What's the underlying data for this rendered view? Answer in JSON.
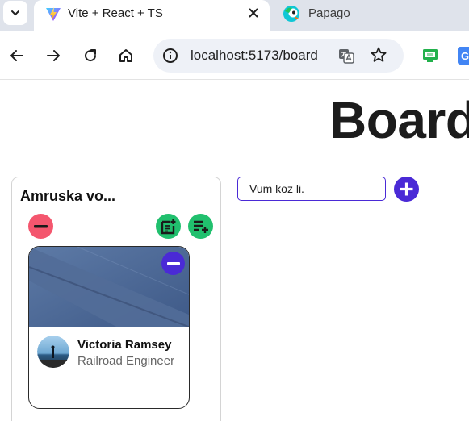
{
  "browser": {
    "tabs": [
      {
        "title": "Vite + React + TS",
        "active": true
      },
      {
        "title": "Papago",
        "active": false
      }
    ],
    "url": "localhost:5173/board"
  },
  "page": {
    "title": "Board",
    "new_list_input": {
      "value": "Vum koz li."
    },
    "lists": [
      {
        "title": "Amruska vo...",
        "cards": [
          {
            "name": "Victoria Ramsey",
            "role": "Railroad Engineer"
          }
        ]
      }
    ]
  },
  "colors": {
    "danger": "#f4566e",
    "success": "#21c06e",
    "accent": "#4a2ad6"
  }
}
